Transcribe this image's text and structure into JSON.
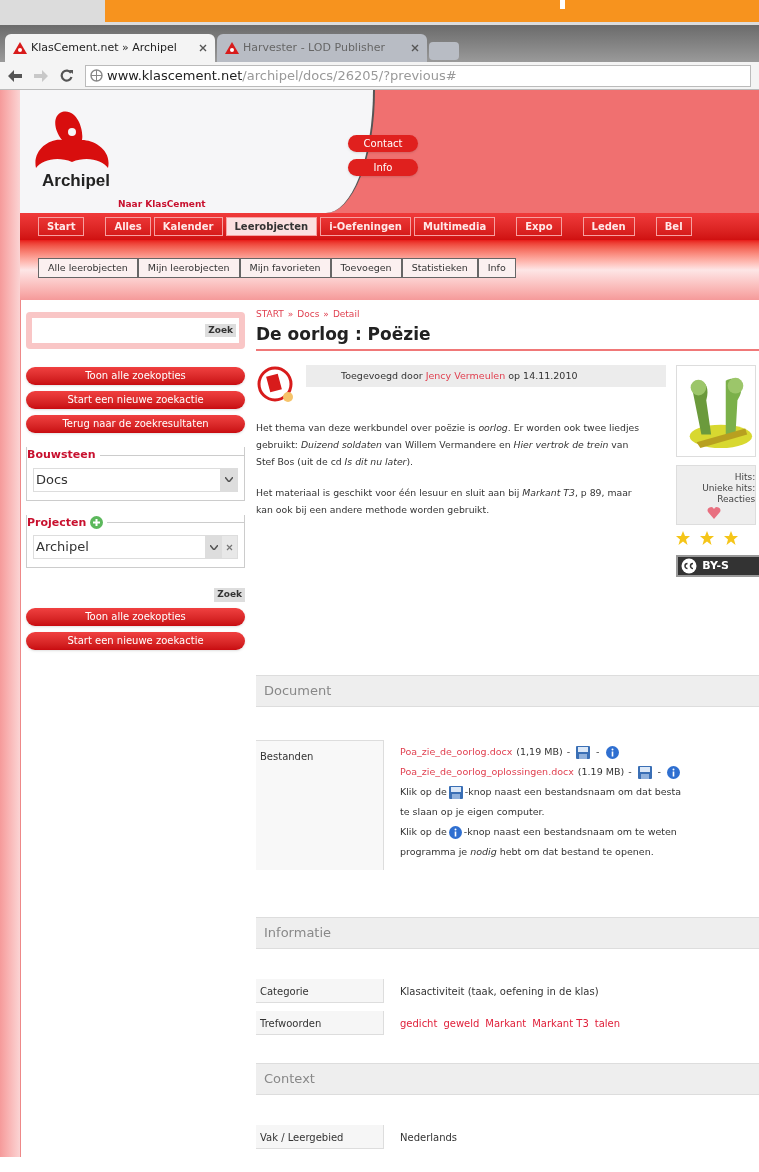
{
  "browser": {
    "tabs": [
      {
        "label": "KlasCement.net » Archipel",
        "selected": true
      },
      {
        "label": "Harvester - LOD Publisher",
        "selected": false
      }
    ],
    "url_host": "www.klascement.net",
    "url_path": "/archipel/docs/26205/?previous#"
  },
  "header": {
    "logo_text": "Archipel",
    "back_link": "Naar KlasCement",
    "buttons": [
      "Contact",
      "Info"
    ]
  },
  "nav": [
    {
      "label": "Start",
      "selected": false
    },
    {
      "label": "Alles",
      "selected": false
    },
    {
      "label": "Kalender",
      "selected": false
    },
    {
      "label": "Leerobjecten",
      "selected": true
    },
    {
      "label": "i-Oefeningen",
      "selected": false
    },
    {
      "label": "Multimedia",
      "selected": false
    },
    {
      "label": "Expo",
      "selected": false
    },
    {
      "label": "Leden",
      "selected": false
    },
    {
      "label": "Bel",
      "selected": false
    }
  ],
  "subnav": [
    "Alle leerobjecten",
    "Mijn leerobjecten",
    "Mijn favorieten",
    "Toevoegen",
    "Statistieken",
    "Info"
  ],
  "sidebar": {
    "search_button": "Zoek",
    "top_buttons": [
      "Toon alle zoekopties",
      "Start een nieuwe zoekactie",
      "Terug naar de zoekresultaten"
    ],
    "filters": [
      {
        "label": "Bouwsteen",
        "value": "Docs",
        "addable": false,
        "clearable": false
      },
      {
        "label": "Projecten",
        "value": "Archipel",
        "addable": true,
        "clearable": true
      }
    ],
    "search_button_2": "Zoek",
    "bottom_buttons": [
      "Toon alle zoekopties",
      "Start een nieuwe zoekactie"
    ]
  },
  "breadcrumb": {
    "items": [
      "START",
      "Docs",
      "Detail"
    ],
    "separator": "»"
  },
  "title": "De oorlog : Poëzie",
  "added": {
    "prefix": "Toegevoegd door",
    "author": "Jency Vermeulen",
    "suffix": "op 14.11.2010"
  },
  "description": [
    "Het thema van deze werkbundel over poëzie is *oorlog*. Er worden ook twee liedjes gebruikt: *Duizend soldaten* van Willem Vermandere en *Hier vertrok de trein* van Stef Bos (uit de cd *Is dit nu later*).",
    "Het materiaal is geschikt voor één lesuur en sluit aan bij *Markant T3*, p 89, maar kan ook bij een andere methode worden gebruikt."
  ],
  "aside": {
    "stats": [
      "Hits:",
      "Unieke hits:",
      "Reacties"
    ],
    "stars": 3,
    "license": "BY-S"
  },
  "document": {
    "heading": "Document",
    "row_label": "Bestanden",
    "separator": "-",
    "files": [
      {
        "name": "Poa_zie_de_oorlog.docx",
        "size": "(1,19 MB)"
      },
      {
        "name": "Poa_zie_de_oorlog_oplossingen.docx",
        "size": "(1.19 MB)"
      }
    ],
    "hints": [
      {
        "kind": "save",
        "before": "Klik op de",
        "after": "-knop naast een bestandsnaam om dat besta"
      },
      {
        "kind": "text",
        "before": "te slaan op je eigen computer."
      },
      {
        "kind": "info",
        "before": "Klik op de",
        "after": "-knop naast een bestandsnaam om te weten"
      },
      {
        "kind": "text",
        "before": "programma je *nodig* hebt om dat bestand te openen."
      }
    ]
  },
  "informatie": {
    "heading": "Informatie",
    "rows": [
      {
        "kind": "text",
        "label": "Categorie",
        "value": "Klasactiviteit (taak, oefening in de klas)"
      },
      {
        "kind": "tags",
        "label": "Trefwoorden",
        "tags": [
          "gedicht",
          "geweld",
          "Markant",
          "Markant T3",
          "talen"
        ]
      }
    ]
  },
  "context": {
    "heading": "Context",
    "rows": [
      {
        "kind": "text",
        "label": "Vak / Leergebied",
        "value": "Nederlands"
      }
    ]
  }
}
